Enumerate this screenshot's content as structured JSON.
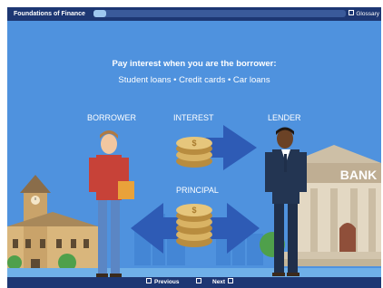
{
  "header": {
    "course_title": "Foundations of Finance",
    "progress": 0.05,
    "glossary_label": "Glossary"
  },
  "slide": {
    "headline": "Pay interest when you are the borrower:",
    "examples": "Student loans  •  Credit cards  •  Car loans",
    "labels": {
      "borrower": "BORROWER",
      "interest": "INTEREST",
      "lender": "LENDER",
      "principal": "PRINCIPAL"
    },
    "bank_sign": "BANK"
  },
  "footer": {
    "previous_label": "Previous",
    "next_label": "Next"
  },
  "colors": {
    "background": "#4f92de",
    "bar": "#1d3773",
    "arrow": "#2e5bb5",
    "coin": "#d9b364"
  }
}
